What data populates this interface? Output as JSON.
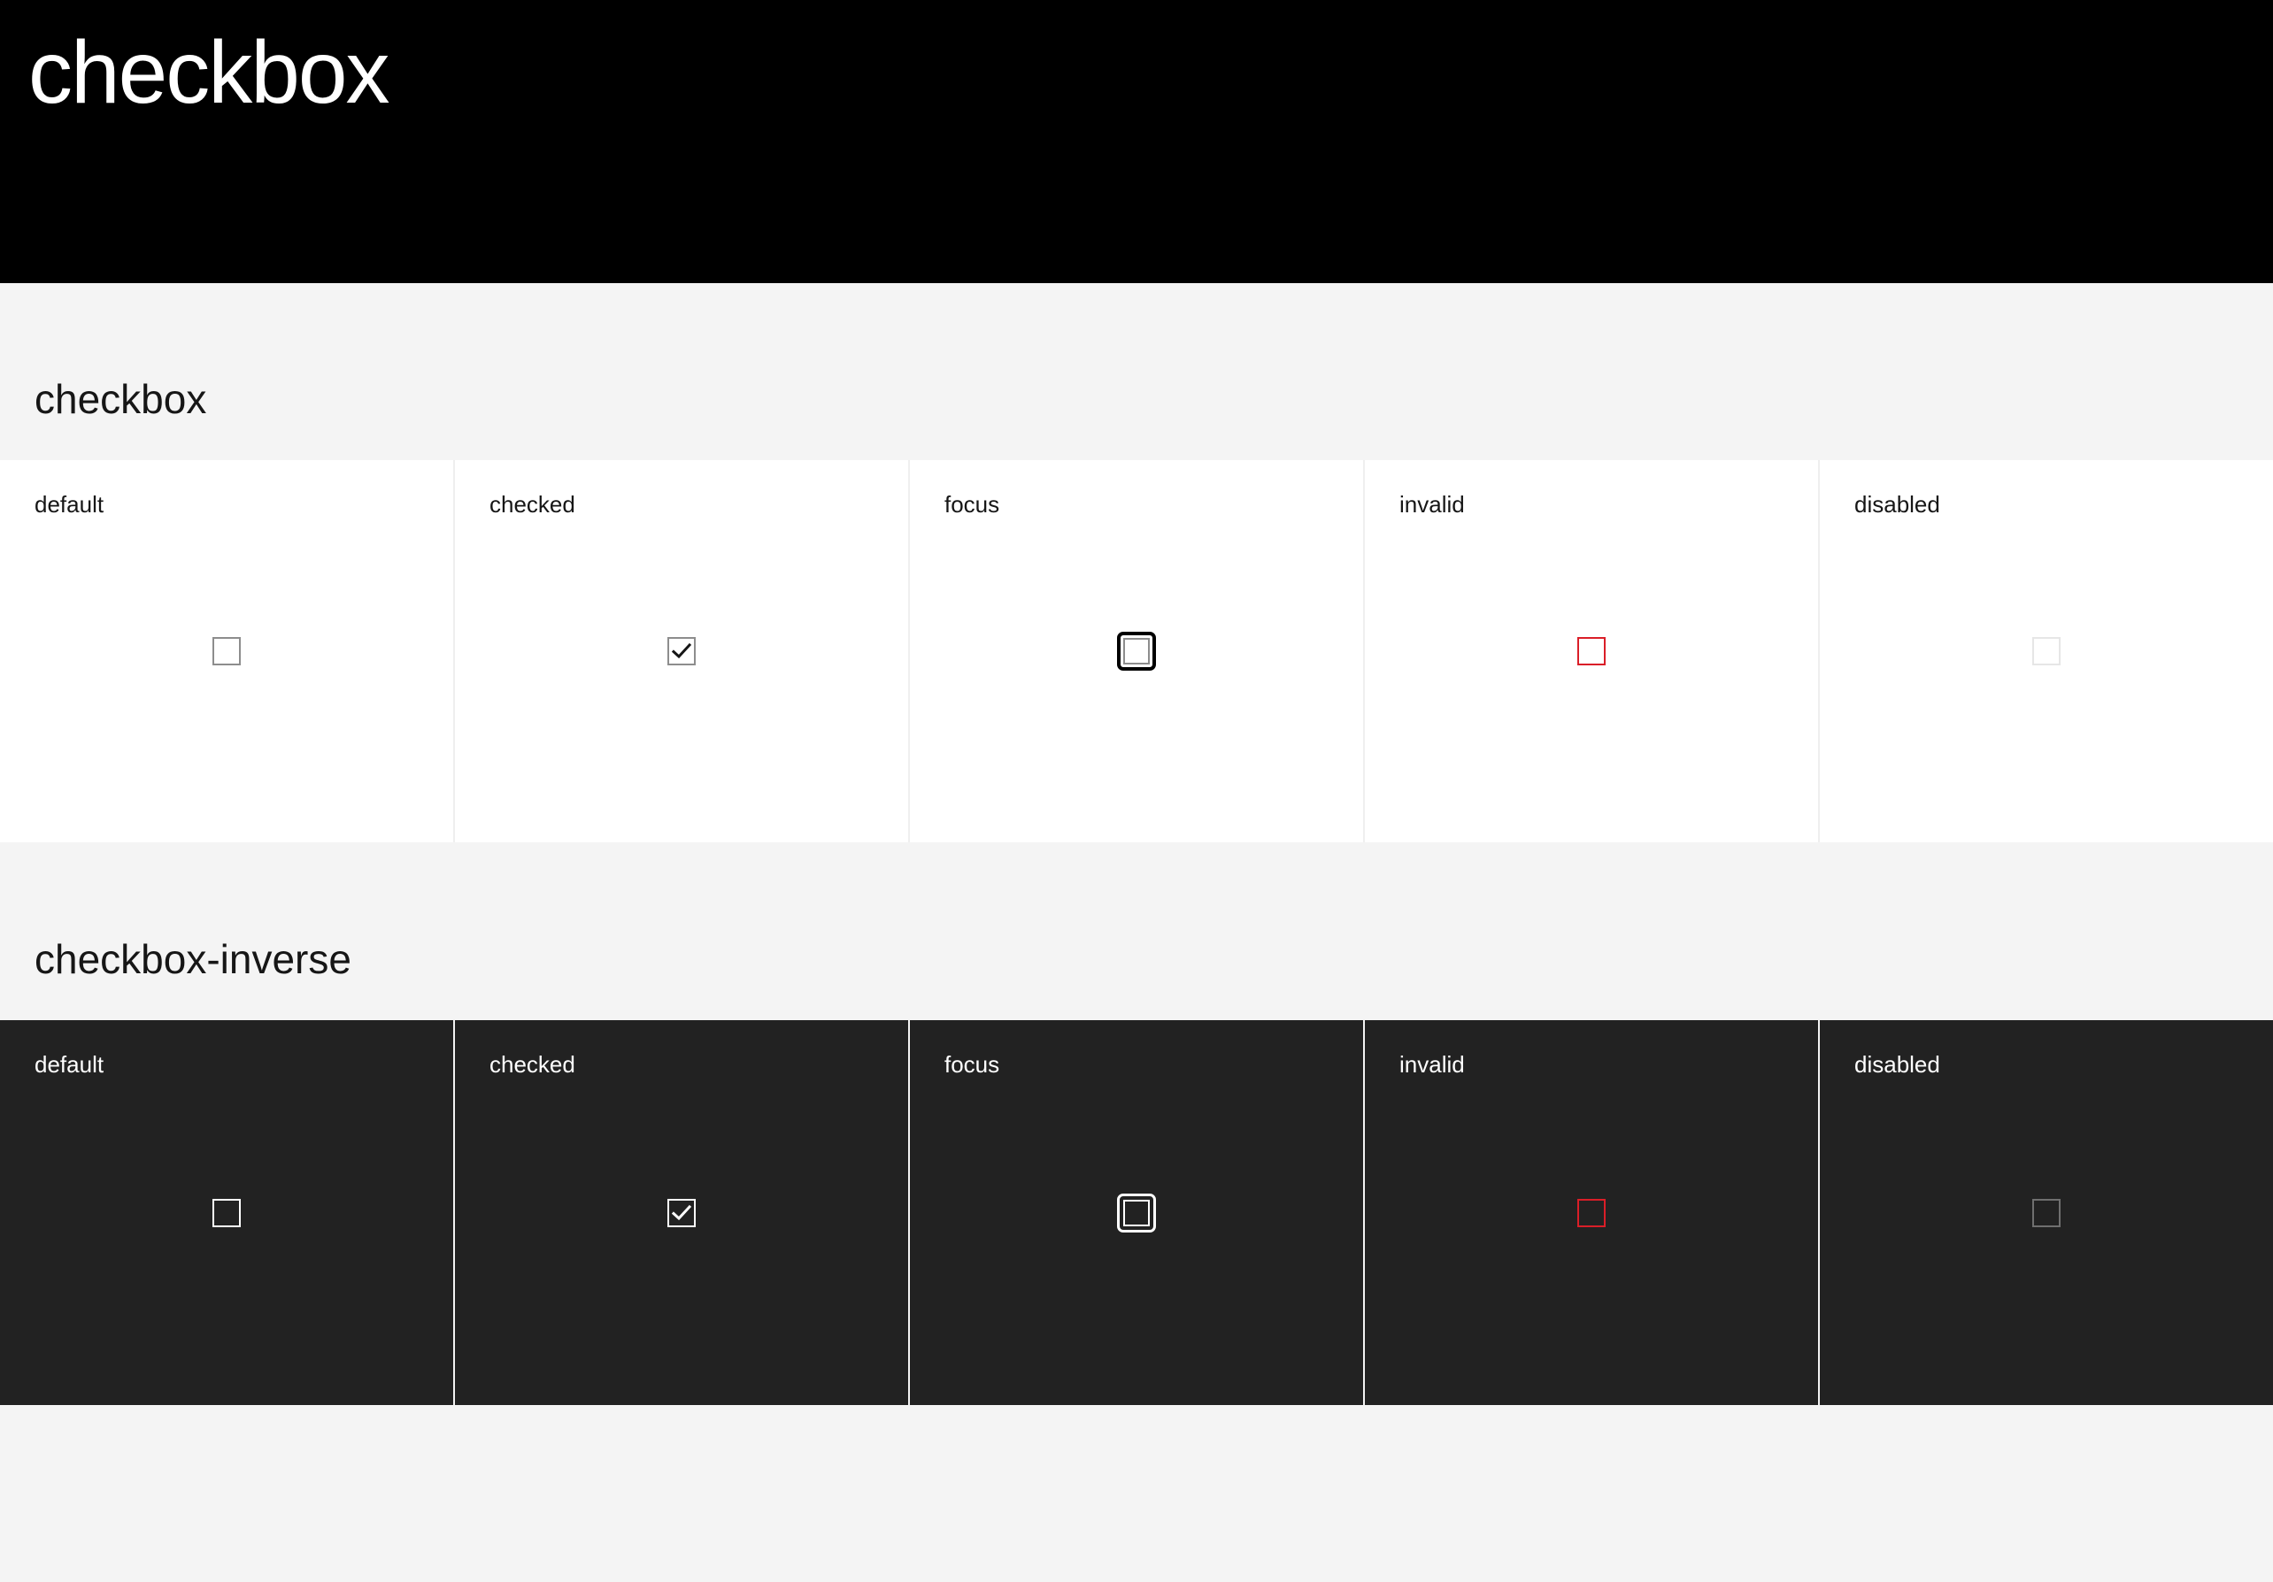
{
  "header": {
    "title": "checkbox",
    "background": "#000000"
  },
  "sections": [
    {
      "title": "checkbox",
      "theme": "light",
      "cells": [
        {
          "label": "default",
          "state": "default",
          "checked": false
        },
        {
          "label": "checked",
          "state": "checked",
          "checked": true
        },
        {
          "label": "focus",
          "state": "focus",
          "checked": false
        },
        {
          "label": "invalid",
          "state": "invalid",
          "checked": false
        },
        {
          "label": "disabled",
          "state": "disabled",
          "checked": false
        }
      ]
    },
    {
      "title": "checkbox-inverse",
      "theme": "dark",
      "cells": [
        {
          "label": "default",
          "state": "default",
          "checked": false
        },
        {
          "label": "checked",
          "state": "checked",
          "checked": true
        },
        {
          "label": "focus",
          "state": "focus",
          "checked": false
        },
        {
          "label": "invalid",
          "state": "invalid",
          "checked": false
        },
        {
          "label": "disabled",
          "state": "disabled",
          "checked": false
        }
      ]
    }
  ],
  "colors": {
    "page_background": "#f4f4f4",
    "dark_panel": "#222222",
    "invalid": "#da1e28",
    "border": "#8d8d8d",
    "disabled_light": "#e6e6e6",
    "disabled_dark": "#6f6f6f"
  },
  "icons": {
    "checkmark": "checkmark-icon"
  }
}
